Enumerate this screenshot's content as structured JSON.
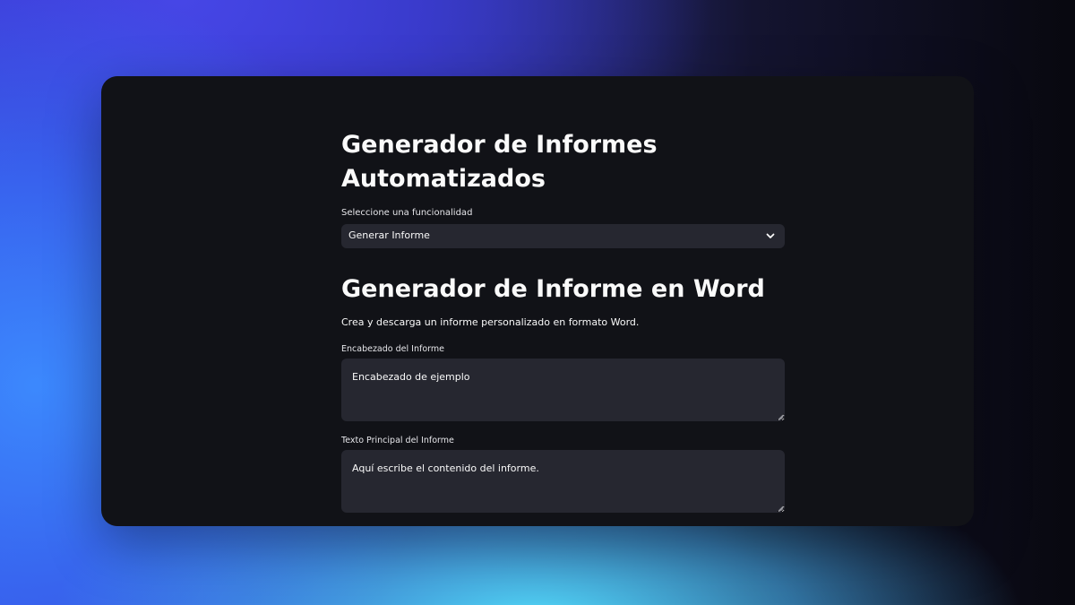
{
  "app": {
    "title": "Generador de Informes Automatizados"
  },
  "feature_select": {
    "label": "Seleccione una funcionalidad",
    "value": "Generar Informe",
    "icon": "chevron-down-icon"
  },
  "section": {
    "title": "Generador de Informe en Word",
    "description": "Crea y descarga un informe personalizado en formato Word."
  },
  "fields": {
    "header": {
      "label": "Encabezado del Informe",
      "value": "Encabezado de ejemplo"
    },
    "body": {
      "label": "Texto Principal del Informe",
      "value": "Aquí escribe el contenido del informe."
    }
  },
  "colors": {
    "card_background": "#111217",
    "input_background": "#262730",
    "text": "#fafafa"
  }
}
